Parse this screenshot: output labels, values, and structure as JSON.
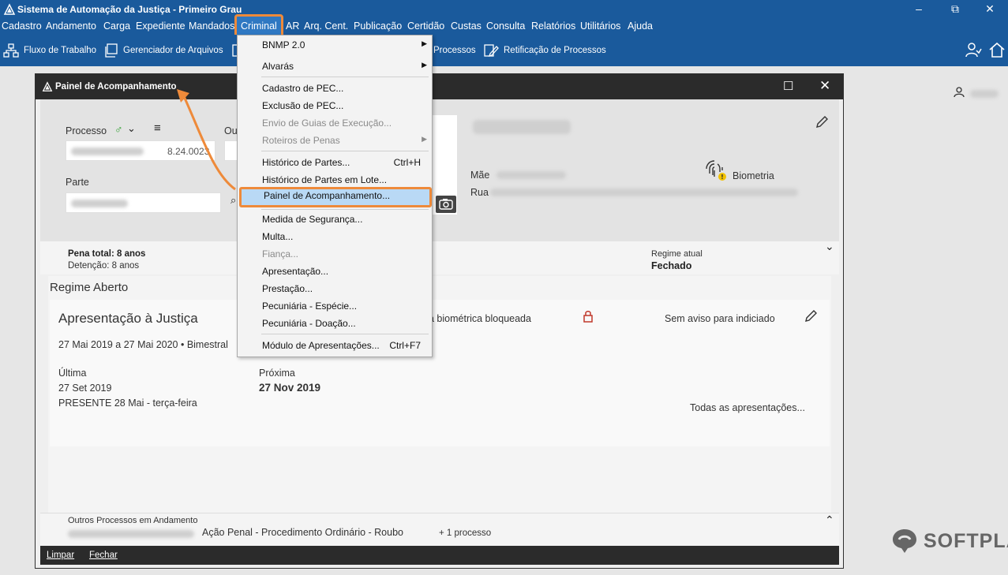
{
  "app": {
    "title": "Sistema de Automação da Justiça - Primeiro Grau",
    "window_controls": [
      "–",
      "⧉",
      "✕"
    ]
  },
  "menubar": {
    "items": [
      "Cadastro",
      "Andamento",
      "Carga",
      "Expediente",
      "Mandados",
      "Criminal",
      "AR",
      "Arq. Cent.",
      "Publicação",
      "Certidão",
      "Custas",
      "Consulta",
      "Relatórios",
      "Utilitários",
      "Ajuda"
    ],
    "active": "Criminal"
  },
  "toolbar": {
    "fluxo": "Fluxo de Trabalho",
    "gerenciador": "Gerenciador de Arquivos",
    "processos": "Processos",
    "retificacao": "Retificação de Processos"
  },
  "panel": {
    "title": "Painel de Acompanhamento",
    "processo_label": "Processo",
    "processo_suffix": "8.24.0023",
    "outros_label": "Ou",
    "parte_label": "Parte",
    "mae_label": "Mãe",
    "rua_label": "Rua",
    "biometria": "Biometria",
    "pena_total": "Pena total: 8 anos",
    "detencao": "Detenção: 8 anos",
    "regime_atual_label": "Regime atual",
    "regime_atual_value": "Fechado",
    "regime_aberto": "Regime Aberto",
    "apresentacao_title": "Apresentação à Justiça",
    "apresentacao_period": "27 Mai 2019 a 27 Mai 2020 • Bimestral",
    "biometria_bloqueada": "a biométrica bloqueada",
    "sem_aviso": "Sem aviso para indiciado",
    "ultima_label": "Última",
    "ultima_date": "27 Set 2019",
    "ultima_status": "PRESENTE 28 Mai - terça-feira",
    "proxima_label": "Próxima",
    "proxima_date": "27 Nov 2019",
    "todas": "Todas as apresentações...",
    "outros_processos": "Outros Processos em Andamento",
    "acao_penal": "Ação Penal - Procedimento Ordinário - Roubo",
    "mais_processo": "+ 1 processo",
    "limpar": "Limpar",
    "fechar": "Fechar"
  },
  "dropdown": {
    "items": [
      {
        "label": "BNMP 2.0",
        "shortcut": "",
        "submenu": true,
        "disabled": false
      },
      {
        "label": "Alvarás",
        "shortcut": "",
        "submenu": true,
        "disabled": false
      },
      {
        "label": "Cadastro de PEC...",
        "shortcut": "",
        "submenu": false,
        "disabled": false
      },
      {
        "label": "Exclusão de PEC...",
        "shortcut": "",
        "submenu": false,
        "disabled": false
      },
      {
        "label": "Envio de Guias de Execução...",
        "shortcut": "",
        "submenu": false,
        "disabled": true
      },
      {
        "label": "Roteiros de Penas",
        "shortcut": "",
        "submenu": true,
        "disabled": true
      },
      {
        "label": "Histórico de Partes...",
        "shortcut": "Ctrl+H",
        "submenu": false,
        "disabled": false
      },
      {
        "label": "Histórico de Partes em Lote...",
        "shortcut": "",
        "submenu": false,
        "disabled": false
      },
      {
        "label": "Painel de Acompanhamento...",
        "shortcut": "",
        "submenu": false,
        "disabled": false,
        "highlighted": true
      },
      {
        "label": "Medida de Segurança...",
        "shortcut": "",
        "submenu": false,
        "disabled": false
      },
      {
        "label": "Multa...",
        "shortcut": "",
        "submenu": false,
        "disabled": false
      },
      {
        "label": "Fiança...",
        "shortcut": "",
        "submenu": false,
        "disabled": true
      },
      {
        "label": "Apresentação...",
        "shortcut": "",
        "submenu": false,
        "disabled": false
      },
      {
        "label": "Prestação...",
        "shortcut": "",
        "submenu": false,
        "disabled": false
      },
      {
        "label": "Pecuniária - Espécie...",
        "shortcut": "",
        "submenu": false,
        "disabled": false
      },
      {
        "label": "Pecuniária - Doação...",
        "shortcut": "",
        "submenu": false,
        "disabled": false
      },
      {
        "label": "Módulo de Apresentações...",
        "shortcut": "Ctrl+F7",
        "submenu": false,
        "disabled": false
      }
    ]
  },
  "watermark": "SOFTPLAN",
  "colors": {
    "brand_blue": "#1a5a9c",
    "highlight_orange": "#ee8a3a",
    "menu_highlight": "#b9d9f5",
    "dark_bar": "#2b2b2b"
  }
}
